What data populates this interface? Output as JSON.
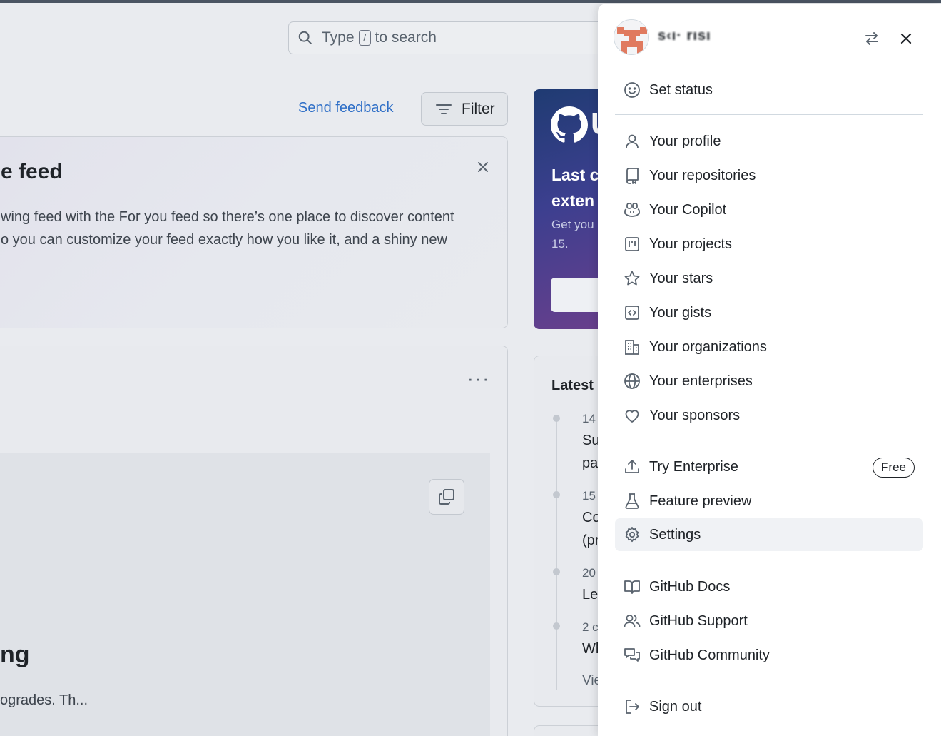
{
  "header": {
    "search": {
      "prefix": "Type",
      "key": "/",
      "suffix": "to search"
    }
  },
  "feed": {
    "send_feedback": "Send feedback",
    "filter_label": "Filter",
    "announcement": {
      "title": "e feed",
      "line1": "wing feed with the For you feed so there’s one place to discover content",
      "line2": "o you can customize your feed exactly how you like it, and a shiny new"
    },
    "more_label": "···",
    "post": {
      "title": "ng",
      "snippet": "ogrades. Th..."
    }
  },
  "promo": {
    "logo_letter": "U",
    "heading_line1": "Last c",
    "heading_line2": "exten",
    "text_line1": "Get you",
    "text_line2": "15."
  },
  "changelog": {
    "title": "Latest c",
    "entries": [
      {
        "date": "14",
        "line1": "Su",
        "line2": "pa"
      },
      {
        "date": "15",
        "line1": "Co",
        "line2": "(pr"
      },
      {
        "date": "20",
        "line1": "Le",
        "line2": ""
      },
      {
        "date": "2 c",
        "line1": "Wh",
        "line2": ""
      }
    ],
    "view_more": "Vie"
  },
  "user_menu": {
    "username": "s‹ı· rısı",
    "set_status": "Set status",
    "items_group1": [
      {
        "label": "Your profile",
        "icon": "person-icon"
      },
      {
        "label": "Your repositories",
        "icon": "repo-icon"
      },
      {
        "label": "Your Copilot",
        "icon": "copilot-icon"
      },
      {
        "label": "Your projects",
        "icon": "project-icon"
      },
      {
        "label": "Your stars",
        "icon": "star-icon"
      },
      {
        "label": "Your gists",
        "icon": "code-square-icon"
      },
      {
        "label": "Your organizations",
        "icon": "organization-icon"
      },
      {
        "label": "Your enterprises",
        "icon": "globe-icon"
      },
      {
        "label": "Your sponsors",
        "icon": "heart-icon"
      }
    ],
    "try_enterprise": "Try Enterprise",
    "free_badge": "Free",
    "feature_preview": "Feature preview",
    "settings": "Settings",
    "items_group3": [
      {
        "label": "GitHub Docs",
        "icon": "book-icon"
      },
      {
        "label": "GitHub Support",
        "icon": "people-icon"
      },
      {
        "label": "GitHub Community",
        "icon": "comment-discussion-icon"
      }
    ],
    "sign_out": "Sign out"
  }
}
